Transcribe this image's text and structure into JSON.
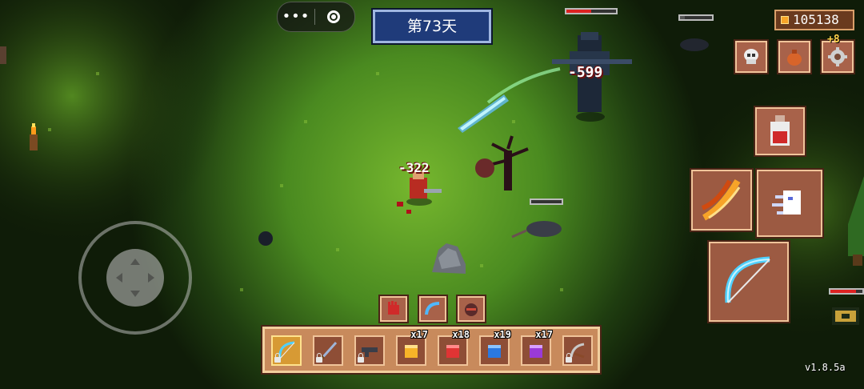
{
  "day_label": "第73天",
  "coins": "105138",
  "forge_bonus": "+8",
  "version": "v1.8.5a",
  "damage_numbers": {
    "boss_hit": "-599",
    "player_hit": "-322"
  },
  "top_right_buttons": [
    "skull-icon",
    "loot-bag-icon",
    "settings-gear-icon"
  ],
  "quick_items": [
    "red-glove-icon",
    "blue-boomerang-icon",
    "bomb-icon"
  ],
  "skills": [
    "health-potion-icon",
    "flame-slash-icon",
    "dash-skill-icon",
    "ice-bow-icon"
  ],
  "hotbar": [
    {
      "icon": "bow-icon",
      "count": "",
      "locked": true,
      "selected": true
    },
    {
      "icon": "sword-icon",
      "count": "",
      "locked": true,
      "selected": false
    },
    {
      "icon": "blaster-icon",
      "count": "",
      "locked": true,
      "selected": false
    },
    {
      "icon": "yellow-potion-icon",
      "count": "x17",
      "locked": false,
      "selected": false
    },
    {
      "icon": "red-potion-icon",
      "count": "x18",
      "locked": false,
      "selected": false
    },
    {
      "icon": "blue-potion-icon",
      "count": "x19",
      "locked": false,
      "selected": false
    },
    {
      "icon": "purple-potion-icon",
      "count": "x17",
      "locked": false,
      "selected": false
    },
    {
      "icon": "crossbow-icon",
      "count": "",
      "locked": true,
      "selected": false
    }
  ],
  "colors": {
    "grass_bright": "#6fb02c",
    "grass_dark": "#10220a",
    "slot_bg": "#a8624a",
    "slot_border": "#f0c49a",
    "banner_bg": "#1f3b7a"
  }
}
